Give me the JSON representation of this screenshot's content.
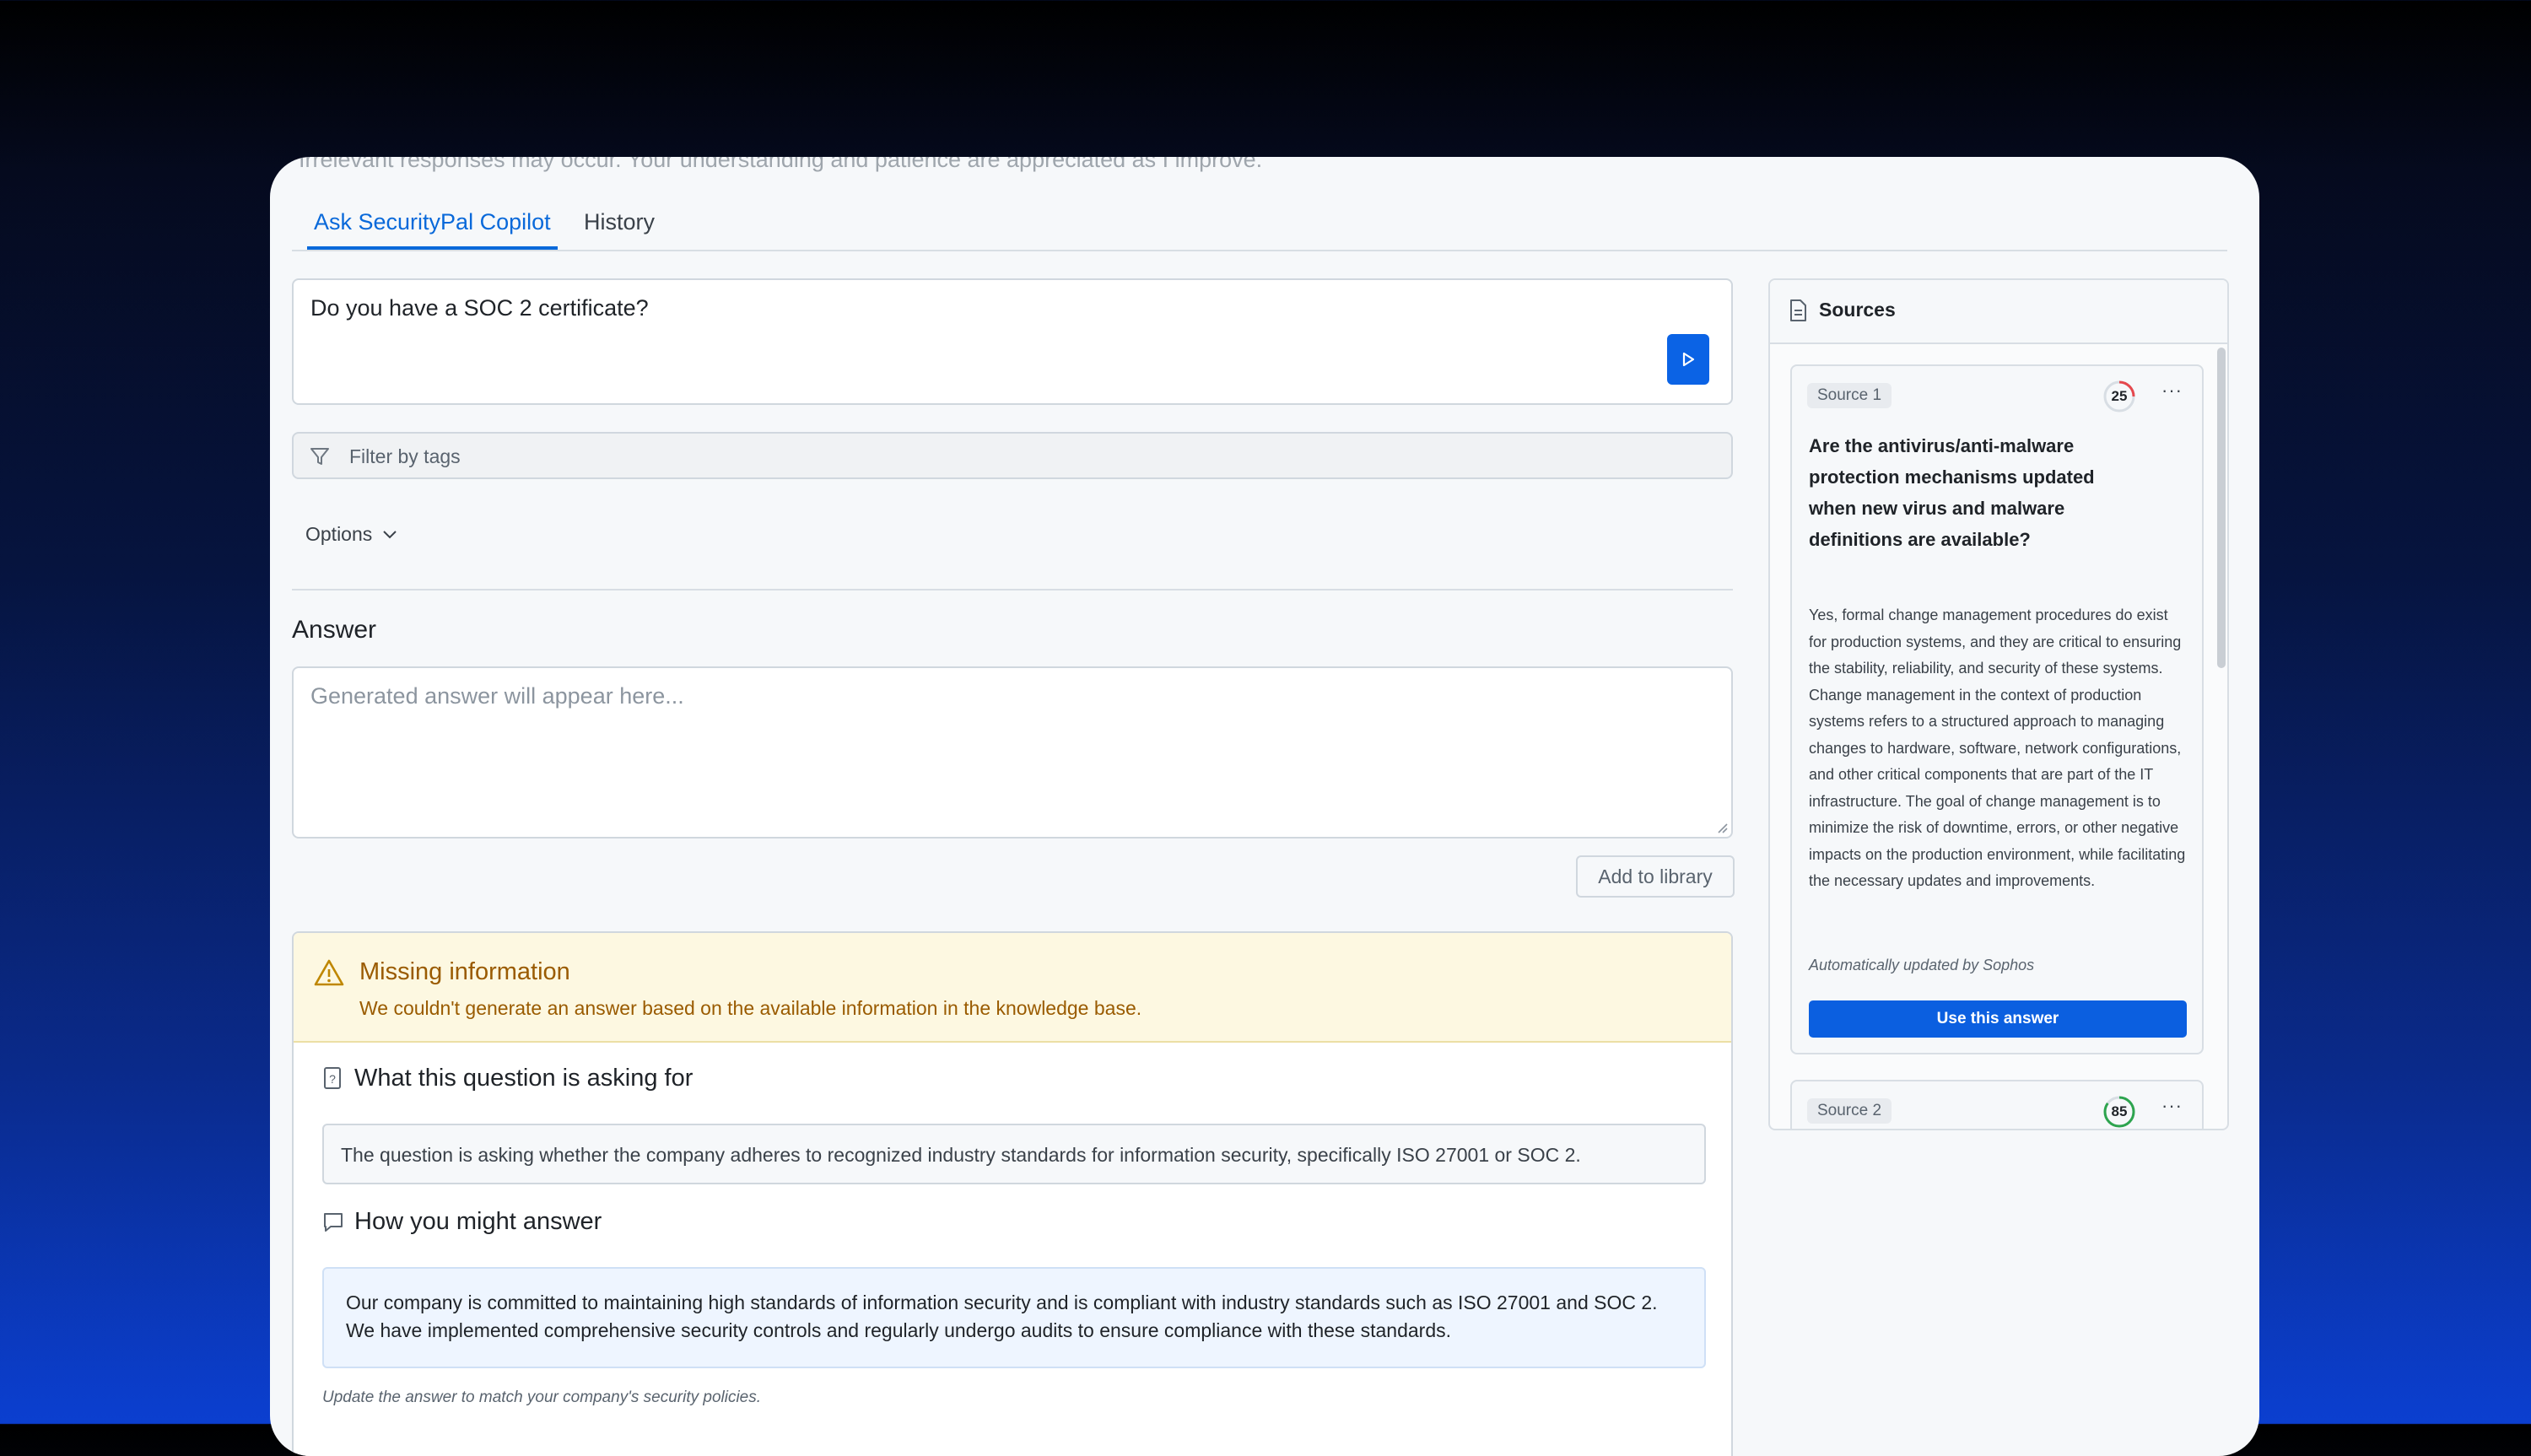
{
  "ghost_text": "Irrelevant responses may occur. Your understanding and patience are appreciated as I improve.",
  "tabs": [
    {
      "label": "Ask SecurityPal Copilot",
      "active": true
    },
    {
      "label": "History",
      "active": false
    }
  ],
  "question": {
    "value": "Do you have a SOC 2 certificate?"
  },
  "filter": {
    "placeholder": "Filter by tags"
  },
  "options_label": "Options",
  "answer": {
    "heading": "Answer",
    "placeholder": "Generated answer will appear here...",
    "add_to_library": "Add to library"
  },
  "missing": {
    "title": "Missing information",
    "description": "We couldn't generate an answer based on the available information in the knowledge base.",
    "asking_heading": "What this question is asking for",
    "asking_text": "The question is asking whether the company adheres to recognized industry standards for information security, specifically ISO 27001 or SOC 2.",
    "how_heading": "How you might answer",
    "how_text": "Our company is committed to maintaining high standards of information security and is compliant with industry standards such as ISO 27001 and SOC 2. We have implemented comprehensive security controls and regularly undergo audits to ensure compliance with these standards.",
    "hint": "Update the answer to match your company's security policies."
  },
  "sources": {
    "title": "Sources",
    "items": [
      {
        "label": "Source 1",
        "score": "25",
        "score_color": "#e5484d",
        "question": "Are the antivirus/anti-malware protection mechanisms updated when new virus and malware definitions are available?",
        "answer": "Yes, formal change management procedures do exist for production systems, and they are critical to ensuring the stability, reliability, and security of these systems. Change management in the context of production systems refers to a structured approach to managing changes to hardware, software, network configurations, and other critical components that are part of the IT infrastructure. The goal of change management is to minimize the risk of downtime, errors, or other negative impacts on the production environment, while facilitating the necessary updates and improvements.",
        "auto": "Automatically updated by Sophos",
        "use_label": "Use this answer"
      },
      {
        "label": "Source 2",
        "score": "85",
        "score_color": "#2da44e"
      }
    ]
  },
  "colors": {
    "accent": "#0969da",
    "button": "#0b5fe0",
    "warning": "#9a5b00"
  }
}
